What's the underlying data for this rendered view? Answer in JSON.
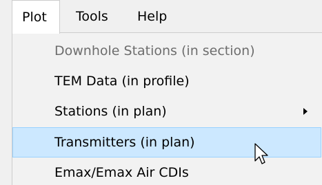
{
  "menubar": {
    "items": [
      {
        "label": "Plot"
      },
      {
        "label": "Tools"
      },
      {
        "label": "Help"
      }
    ]
  },
  "dropdown": {
    "items": [
      {
        "label": "Downhole Stations (in section)",
        "state": "disabled"
      },
      {
        "label": "TEM Data (in profile)",
        "state": "normal"
      },
      {
        "label": "Stations (in plan)",
        "state": "normal",
        "has_submenu": true
      },
      {
        "label": "Transmitters (in plan)",
        "state": "highlighted"
      },
      {
        "label": "Emax/Emax Air CDIs",
        "state": "normal"
      }
    ]
  },
  "colors": {
    "background": "#f0f0f0",
    "highlight_fill": "#cce8ff",
    "highlight_border": "#99d1ff",
    "disabled_text": "#6d6d6d"
  }
}
